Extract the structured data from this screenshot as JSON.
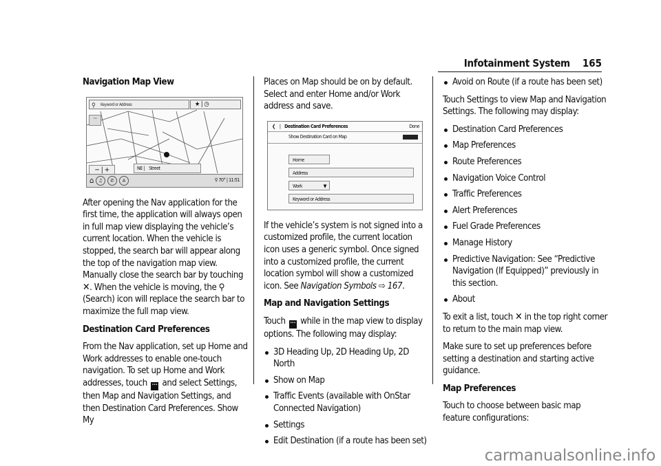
{
  "header": {
    "section_title": "Infotainment System",
    "page_number": "165"
  },
  "col1": {
    "heading": "Navigation Map View",
    "figure_nav": {
      "search_placeholder": "Keyword or Address",
      "favorite_symbol": "★ | ◷",
      "more_symbol": "···",
      "zoom_controls": "− | +",
      "heading_label": "NE |",
      "street_label": "Street",
      "temperature": "70°",
      "clock": "11:51"
    },
    "para1_a": "After opening the Nav application for the first time, the application will always open in full map view displaying the vehicle’s current location. When the vehicle is stopped, the search bar will appear along the top of the navigation map view. Manually close the search bar by touching",
    "para1_b": ". When the vehicle is moving, the",
    "para1_c": "(Search) icon will replace the search bar to maximize the full map view.",
    "heading2": "Destination Card Preferences",
    "para2_a": "From the Nav application, set up Home and Work addresses to enable one-touch navigation. To set up Home and Work addresses, touch",
    "para2_b": "and select Settings, then Map and Navigation Settings, and then Destination Card Preferences. Show My"
  },
  "col2": {
    "para1": "Places on Map should be on by default. Select and enter Home and/or Work address and save.",
    "figure_dest": {
      "title": "Destination Card Preferences",
      "done": "Done",
      "toggle_label": "Show Destination Card on Map",
      "home": "Home",
      "address": "Address",
      "work": "Work",
      "keyword": "Keyword or Address"
    },
    "para2": "If the vehicle’s system is not signed into a customized profile, the current location icon uses a generic symbol. Once signed into a customized profile, the current location symbol will show a customized icon. See",
    "ref_text": "Navigation Symbols",
    "ref_arrow": "⇨",
    "ref_page": "167",
    "heading": "Map and Navigation Settings",
    "para3_a": "Touch",
    "para3_b": "while in the map view to display options. The following may display:",
    "bullets": [
      "3D Heading Up, 2D Heading Up, 2D North",
      "Show on Map",
      "Traffic Events (available with OnStar Connected Navigation)",
      "Settings",
      "Edit Destination (if a route has been set)"
    ]
  },
  "col3": {
    "bullet_top": "Avoid on Route (if a route has been set)",
    "para1": "Touch Settings to view Map and Navigation Settings. The following may display:",
    "bullets": [
      "Destination Card Preferences",
      "Map Preferences",
      "Route Preferences",
      "Navigation Voice Control",
      "Traffic Preferences",
      "Alert Preferences",
      "Fuel Grade Preferences",
      "Manage History",
      "Predictive Navigation: See “Predictive Navigation (If Equipped)” previously in this section.",
      "About"
    ],
    "para2_a": "To exit a list, touch",
    "para2_b": "in the top right corner to return to the main map view.",
    "para3": "Make sure to set up preferences before setting a destination and starting active guidance.",
    "heading": "Map Preferences",
    "para4": "Touch to choose between basic map feature configurations:"
  },
  "icons": {
    "close": "✕",
    "search": "⚲",
    "more": "···"
  },
  "watermark": "carmanualsonline.info"
}
